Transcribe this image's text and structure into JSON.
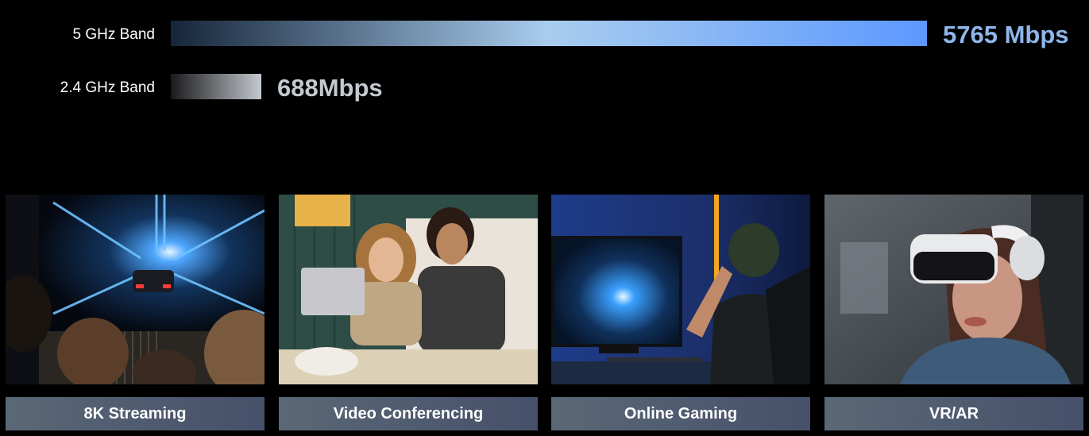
{
  "chart_data": {
    "type": "bar",
    "orientation": "horizontal",
    "categories": [
      "5 GHz Band",
      "2.4 GHz Band"
    ],
    "values": [
      5765,
      688
    ],
    "value_labels": [
      "5765 Mbps",
      "688Mbps"
    ],
    "unit": "Mbps",
    "title": "",
    "xlabel": "",
    "ylabel": "",
    "xlim": [
      0,
      5765
    ],
    "grid": false,
    "legend": "none"
  },
  "colors": {
    "band_5_gradient": [
      "#16263a",
      "#a9cdee",
      "#5c98ff"
    ],
    "band_24_gradient": [
      "#1a1a1c",
      "#c4c9cf"
    ],
    "label_5": "#8fb6ea",
    "label_24": "#c4c9cf",
    "caption_bg": [
      "#5a6876",
      "#46506a"
    ]
  },
  "cards": [
    {
      "label": "8K Streaming",
      "icon": "race-car-tunnel-image"
    },
    {
      "label": "Video Conferencing",
      "icon": "couple-laptop-image"
    },
    {
      "label": "Online Gaming",
      "icon": "gamer-monitor-image"
    },
    {
      "label": "VR/AR",
      "icon": "vr-headset-image"
    }
  ]
}
